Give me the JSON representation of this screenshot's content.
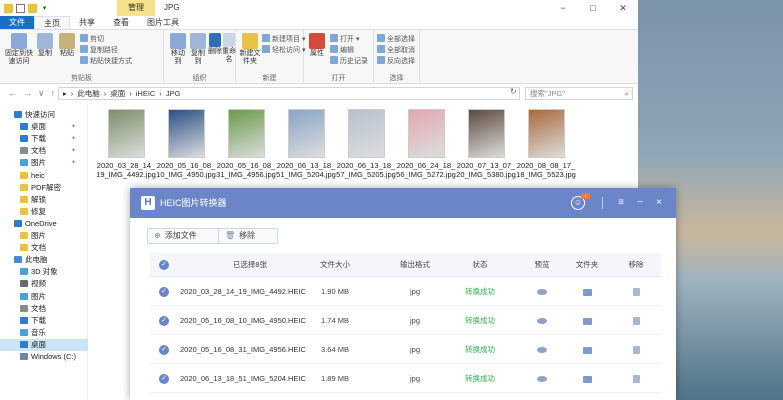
{
  "explorer": {
    "qat_icons": [
      "folder-icon",
      "check-icon",
      "folder-icon"
    ],
    "context_tab": "管理",
    "window_title": "JPG",
    "ribbon_tabs": [
      "文件",
      "主页",
      "共享",
      "查看",
      "图片工具"
    ],
    "groups": {
      "clipboard": {
        "label": "剪贴板",
        "pin": "固定到快速访问",
        "copy": "复制",
        "paste": "粘贴",
        "cut": "剪切",
        "copy_path": "复制路径",
        "paste_shortcut": "粘贴快捷方式"
      },
      "organize": {
        "label": "组织",
        "move_to": "移动到",
        "copy_to": "复制到",
        "delete": "删除",
        "rename": "重命名"
      },
      "new": {
        "label": "新建",
        "new_folder": "新建文件夹",
        "new_item": "新建项目 ▾",
        "easy_access": "轻松访问 ▾"
      },
      "open": {
        "label": "打开",
        "properties": "属性",
        "open": "打开 ▾",
        "edit": "编辑",
        "history": "历史记录"
      },
      "select": {
        "label": "选择",
        "select_all": "全部选择",
        "select_none": "全部取消",
        "invert": "反向选择"
      }
    },
    "breadcrumb": [
      "此电脑",
      "桌面",
      "iHEIC",
      "JPG"
    ],
    "search_placeholder": "搜索\"JPG\"",
    "nav": [
      {
        "label": "快速访问",
        "color": "#2f7ad1",
        "pin": false,
        "selected": false,
        "indent": 0
      },
      {
        "label": "桌面",
        "color": "#2f7ad1",
        "pin": true,
        "selected": false,
        "indent": 1
      },
      {
        "label": "下载",
        "color": "#2f7ad1",
        "pin": true,
        "selected": false,
        "indent": 1
      },
      {
        "label": "文档",
        "color": "#8a8a8a",
        "pin": true,
        "selected": false,
        "indent": 1
      },
      {
        "label": "图片",
        "color": "#4aa0d8",
        "pin": true,
        "selected": false,
        "indent": 1
      },
      {
        "label": "heic",
        "color": "#e8c14a",
        "pin": false,
        "selected": false,
        "indent": 1
      },
      {
        "label": "PDF解密",
        "color": "#e8c14a",
        "pin": false,
        "selected": false,
        "indent": 1
      },
      {
        "label": "解锁",
        "color": "#e8c14a",
        "pin": false,
        "selected": false,
        "indent": 1
      },
      {
        "label": "修复",
        "color": "#e8c14a",
        "pin": false,
        "selected": false,
        "indent": 1
      },
      {
        "label": "OneDrive",
        "color": "#2f7ad1",
        "pin": false,
        "selected": false,
        "indent": 0
      },
      {
        "label": "图片",
        "color": "#e8c14a",
        "pin": false,
        "selected": false,
        "indent": 1
      },
      {
        "label": "文档",
        "color": "#e8c14a",
        "pin": false,
        "selected": false,
        "indent": 1
      },
      {
        "label": "此电脑",
        "color": "#4a8ad0",
        "pin": false,
        "selected": false,
        "indent": 0
      },
      {
        "label": "3D 对象",
        "color": "#4aa0d8",
        "pin": false,
        "selected": false,
        "indent": 1
      },
      {
        "label": "视频",
        "color": "#6a6a6a",
        "pin": false,
        "selected": false,
        "indent": 1
      },
      {
        "label": "图片",
        "color": "#4aa0d8",
        "pin": false,
        "selected": false,
        "indent": 1
      },
      {
        "label": "文档",
        "color": "#8a8a8a",
        "pin": false,
        "selected": false,
        "indent": 1
      },
      {
        "label": "下载",
        "color": "#2f7ad1",
        "pin": false,
        "selected": false,
        "indent": 1
      },
      {
        "label": "音乐",
        "color": "#4aa0d8",
        "pin": false,
        "selected": false,
        "indent": 1
      },
      {
        "label": "桌面",
        "color": "#2f7ad1",
        "pin": false,
        "selected": true,
        "indent": 1
      },
      {
        "label": "Windows (C:)",
        "color": "#6a8aa8",
        "pin": false,
        "selected": false,
        "indent": 1
      }
    ],
    "files": [
      {
        "name": "2020_03_28_14_19_IMG_4492.jpg",
        "tone": "#7b8f6a"
      },
      {
        "name": "2020_05_16_08_10_IMG_4950.jpg",
        "tone": "#2a4f86"
      },
      {
        "name": "2020_05_16_08_31_IMG_4956.jpg",
        "tone": "#6a9a4a"
      },
      {
        "name": "2020_06_13_18_51_IMG_5204.jpg",
        "tone": "#8aa4c6"
      },
      {
        "name": "2020_06_13_18_57_IMG_5205.jpg",
        "tone": "#b6c2d0"
      },
      {
        "name": "2020_06_24_18_56_IMG_5272.jpg",
        "tone": "#e3a7b0"
      },
      {
        "name": "2020_07_13_07_20_IMG_5380.jpg",
        "tone": "#5b4a3e"
      },
      {
        "name": "2020_08_08_17_18_IMG_5523.jpg",
        "tone": "#a86a3a"
      }
    ]
  },
  "converter": {
    "logo": "H",
    "title": "HEIC图片转换器",
    "vip_badge": "•",
    "controls": [
      "≡",
      "−",
      "×"
    ],
    "add_button": "添加文件",
    "remove_button": "移除",
    "columns": [
      "已选择8张",
      "文件大小",
      "输出格式",
      "状态",
      "预览",
      "文件夹",
      "移除"
    ],
    "rows": [
      {
        "name": "2020_03_28_14_19_IMG_4492.HEIC",
        "size": "1.90 MB",
        "format": "jpg",
        "status": "转换成功"
      },
      {
        "name": "2020_05_16_08_10_IMG_4950.HEIC",
        "size": "1.74 MB",
        "format": "jpg",
        "status": "转换成功"
      },
      {
        "name": "2020_05_16_08_31_IMG_4956.HEIC",
        "size": "3.64 MB",
        "format": "jpg",
        "status": "转换成功"
      },
      {
        "name": "2020_06_13_18_51_IMG_5204.HEIC",
        "size": "1.89 MB",
        "format": "jpg",
        "status": "转换成功"
      }
    ],
    "colors": {
      "header": "#6a86c8",
      "success": "#2bb34a"
    }
  }
}
